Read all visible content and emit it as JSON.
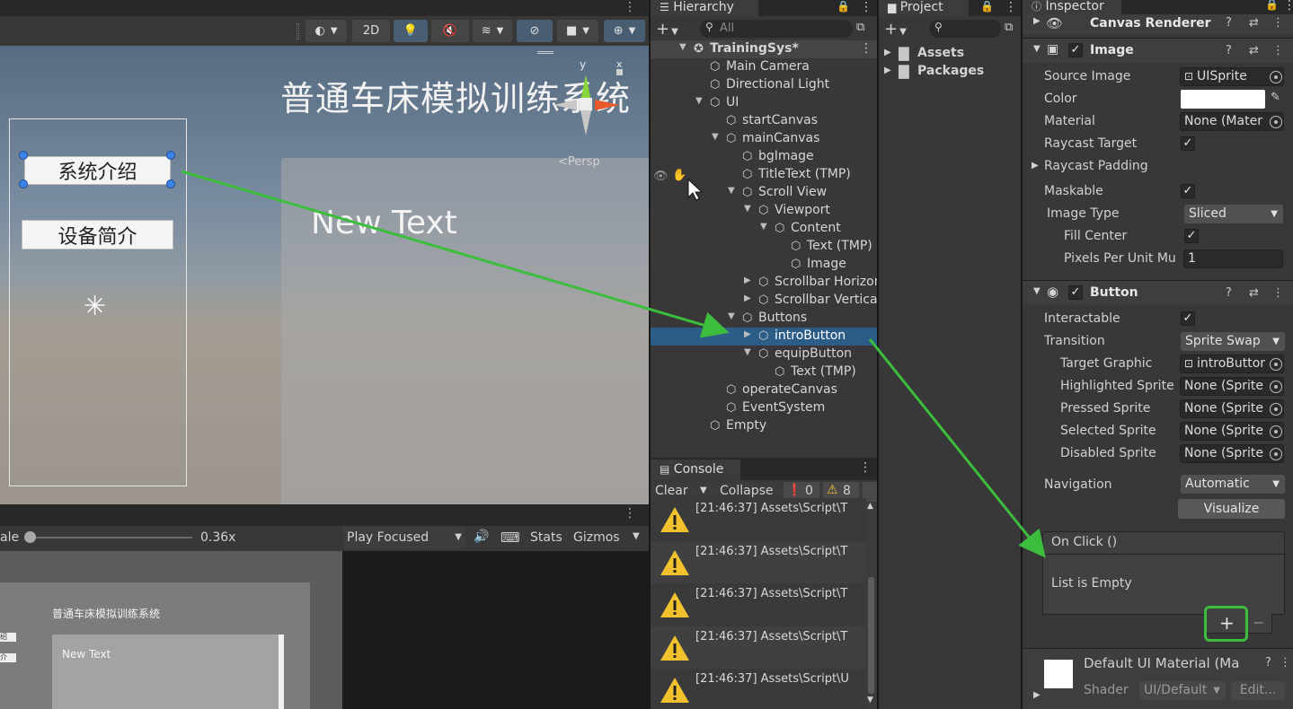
{
  "scene": {
    "toolbar": {
      "btn_2d": "2D"
    },
    "title_text": "普通车床模拟训练系统",
    "new_text": "New Text",
    "buttons": [
      "系统介绍",
      "设备简介"
    ],
    "gizmo_axis_y": "y",
    "gizmo_axis_x": "x",
    "persp_label": "<Persp"
  },
  "game": {
    "scale_label": "ale",
    "scale_value": "0.36x",
    "play_mode": "Play Focused",
    "stats_label": "Stats",
    "gizmos_label": "Gizmos",
    "preview_title": "普通车床模拟训练系统",
    "preview_new_text": "New Text",
    "preview_btn1": "绍",
    "preview_btn2": "介"
  },
  "hierarchy": {
    "tab_label": "Hierarchy",
    "search_placeholder": "All",
    "items": [
      {
        "label": "TrainingSys*",
        "depth": 0,
        "expanded": true,
        "root": true
      },
      {
        "label": "Main Camera",
        "depth": 1
      },
      {
        "label": "Directional Light",
        "depth": 1
      },
      {
        "label": "UI",
        "depth": 1,
        "expanded": true
      },
      {
        "label": "startCanvas",
        "depth": 2
      },
      {
        "label": "mainCanvas",
        "depth": 2,
        "expanded": true
      },
      {
        "label": "bgImage",
        "depth": 3
      },
      {
        "label": "TitleText (TMP)",
        "depth": 3,
        "hover": true
      },
      {
        "label": "Scroll View",
        "depth": 3,
        "expanded": true
      },
      {
        "label": "Viewport",
        "depth": 4,
        "expanded": true
      },
      {
        "label": "Content",
        "depth": 5,
        "expanded": true
      },
      {
        "label": "Text (TMP)",
        "depth": 6
      },
      {
        "label": "Image",
        "depth": 6
      },
      {
        "label": "Scrollbar Horizontal",
        "depth": 4,
        "collapsed": true
      },
      {
        "label": "Scrollbar Vertical",
        "depth": 4,
        "collapsed": true
      },
      {
        "label": "Buttons",
        "depth": 3,
        "expanded": true
      },
      {
        "label": "introButton",
        "depth": 4,
        "collapsed": true,
        "selected": true
      },
      {
        "label": "equipButton",
        "depth": 4,
        "expanded": true
      },
      {
        "label": "Text (TMP)",
        "depth": 5
      },
      {
        "label": "operateCanvas",
        "depth": 2
      },
      {
        "label": "EventSystem",
        "depth": 2
      },
      {
        "label": "Empty",
        "depth": 1
      }
    ]
  },
  "console": {
    "tab_label": "Console",
    "clear_label": "Clear",
    "collapse_label": "Collapse",
    "error_count": "0",
    "warn_count": "8",
    "logs": [
      "[21:46:37] Assets\\Script\\T",
      "[21:46:37] Assets\\Script\\T",
      "[21:46:37] Assets\\Script\\T",
      "[21:46:37] Assets\\Script\\T",
      "[21:46:37] Assets\\Script\\U"
    ]
  },
  "project": {
    "tab_label": "Project",
    "folders": [
      "Assets",
      "Packages"
    ]
  },
  "inspector": {
    "tab_label": "Inspector",
    "canvas_renderer_label": "Canvas Renderer",
    "image": {
      "header": "Image",
      "source_image_label": "Source Image",
      "source_image_value": "UISprite",
      "color_label": "Color",
      "material_label": "Material",
      "material_value": "None (Mater",
      "raycast_target_label": "Raycast Target",
      "raycast_padding_label": "Raycast Padding",
      "maskable_label": "Maskable",
      "image_type_label": "Image Type",
      "image_type_value": "Sliced",
      "fill_center_label": "Fill Center",
      "ppu_label": "Pixels Per Unit Mu",
      "ppu_value": "1"
    },
    "button": {
      "header": "Button",
      "interactable_label": "Interactable",
      "transition_label": "Transition",
      "transition_value": "Sprite Swap",
      "target_graphic_label": "Target Graphic",
      "target_graphic_value": "introButtor",
      "highlighted_label": "Highlighted Sprite",
      "highlighted_value": "None (Sprite",
      "pressed_label": "Pressed Sprite",
      "pressed_value": "None (Sprite",
      "selected_label": "Selected Sprite",
      "selected_value": "None (Sprite",
      "disabled_label": "Disabled Sprite",
      "disabled_value": "None (Sprite",
      "navigation_label": "Navigation",
      "navigation_value": "Automatic",
      "visualize_label": "Visualize",
      "onclick_header": "On Click ()",
      "list_empty": "List is Empty"
    },
    "material": {
      "name": "Default UI Material (Ma",
      "shader_label": "Shader",
      "shader_value": "UI/Default",
      "edit_label": "Edit..."
    }
  },
  "colors": {
    "selection": "#2c5d87",
    "arrow_green": "#3dbd3d",
    "warning": "#f2c12e"
  }
}
